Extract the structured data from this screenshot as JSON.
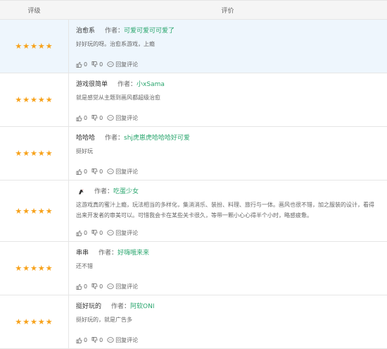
{
  "header": {
    "col_rating": "评级",
    "col_review": "评价"
  },
  "reviews": [
    {
      "stars": "★★★★★",
      "title": "治愈系",
      "author_label": "作者：",
      "author": "可爱可爱可可爱了",
      "content": "好好玩的呀。治愈系游戏，上瘾",
      "likes": "0",
      "dislikes": "0",
      "reply": "回复评论"
    },
    {
      "stars": "★★★★★",
      "title": "游戏很简单",
      "author_label": "作者：",
      "author": "小xSama",
      "content": "就是感觉从主题到画风都超级治愈",
      "likes": "0",
      "dislikes": "0",
      "reply": "回复评论"
    },
    {
      "stars": "★★★★★",
      "title": "哈哈哈",
      "author_label": "作者：",
      "author": "shj虎崽虎哈哈哈好可爱",
      "content": "挺好玩",
      "likes": "0",
      "dislikes": "0",
      "reply": "回复评论"
    },
    {
      "stars": "★★★★★",
      "title": "",
      "author_label": "作者：",
      "author": "吃蛋少女",
      "content": "这游戏真的蜜汁上瘾，玩法相当的多样化，集消消乐、装扮、料理、旅行与一体。画风也很不错，加之服装的设计，看得出来开发者的审美可以。可惜我会卡在某些关卡很久，等带一颗小心心得半个小时，略感疲惫。",
      "likes": "0",
      "dislikes": "0",
      "reply": "回复评论"
    },
    {
      "stars": "★★★★★",
      "title": "串串",
      "author_label": "作者：",
      "author": "好嗨哦来来",
      "content": "还不错",
      "likes": "0",
      "dislikes": "0",
      "reply": "回复评论"
    },
    {
      "stars": "★★★★★",
      "title": "挺好玩的",
      "author_label": "作者：",
      "author": "阿软ONI",
      "content": "挺好玩的，就是广告多",
      "likes": "0",
      "dislikes": "0",
      "reply": "回复评论"
    }
  ],
  "colors": {
    "star": "#f7a21b",
    "author": "#2aa66e",
    "highlight_row": "#eef6fd",
    "border": "#e6e6e6"
  },
  "icons": {
    "like": "thumbs-up-icon",
    "dislike": "thumbs-down-icon",
    "reply": "comment-bubble-icon",
    "avatar": "bird-avatar-icon"
  }
}
